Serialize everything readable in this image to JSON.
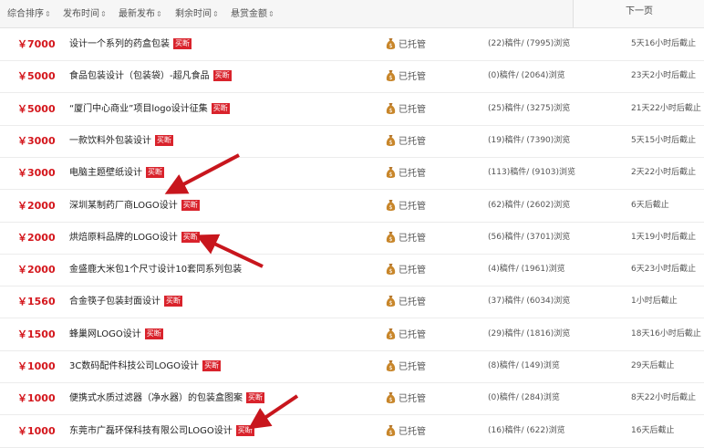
{
  "sort_bar": {
    "items": [
      {
        "label": "综合排序",
        "arrow": "⇕"
      },
      {
        "label": "发布时间",
        "arrow": "⇕"
      },
      {
        "label": "最新发布",
        "arrow": "⇕"
      },
      {
        "label": "剩余时间",
        "arrow": "⇕"
      },
      {
        "label": "悬赏金额",
        "arrow": "⇕"
      }
    ],
    "next_page": "下一页"
  },
  "rows": [
    {
      "price": "￥7000",
      "title": "设计一个系列的药盒包装",
      "tag": "买断",
      "escrow": "已托管",
      "stats": "(22)稿件/ (7995)浏览",
      "deadline": "5天16小时后截止"
    },
    {
      "price": "￥5000",
      "title": "食品包装设计（包装袋）-超凡食品",
      "tag": "买断",
      "escrow": "已托管",
      "stats": "(0)稿件/ (2064)浏览",
      "deadline": "23天2小时后截止"
    },
    {
      "price": "￥5000",
      "title": "“厦门中心商业”项目logo设计征集",
      "tag": "买断",
      "escrow": "已托管",
      "stats": "(25)稿件/ (3275)浏览",
      "deadline": "21天22小时后截止"
    },
    {
      "price": "￥3000",
      "title": "一款饮料外包装设计",
      "tag": "买断",
      "escrow": "已托管",
      "stats": "(19)稿件/ (7390)浏览",
      "deadline": "5天15小时后截止"
    },
    {
      "price": "￥3000",
      "title": "电脑主题壁纸设计",
      "tag": "买断",
      "escrow": "已托管",
      "stats": "(113)稿件/ (9103)浏览",
      "deadline": "2天22小时后截止"
    },
    {
      "price": "￥2000",
      "title": "深圳某制药厂商LOGO设计",
      "tag": "买断",
      "escrow": "已托管",
      "stats": "(62)稿件/ (2602)浏览",
      "deadline": "6天后截止"
    },
    {
      "price": "￥2000",
      "title": "烘焙原料品牌的LOGO设计",
      "tag": "买断",
      "escrow": "已托管",
      "stats": "(56)稿件/ (3701)浏览",
      "deadline": "1天19小时后截止"
    },
    {
      "price": "￥2000",
      "title": "金盛鹿大米包1个尺寸设计10套同系列包装",
      "tag": "",
      "escrow": "已托管",
      "stats": "(4)稿件/ (1961)浏览",
      "deadline": "6天23小时后截止"
    },
    {
      "price": "￥1560",
      "title": "合金筷子包装封面设计",
      "tag": "买断",
      "escrow": "已托管",
      "stats": "(37)稿件/ (6034)浏览",
      "deadline": "1小时后截止"
    },
    {
      "price": "￥1500",
      "title": "蜂巢网LOGO设计",
      "tag": "买断",
      "escrow": "已托管",
      "stats": "(29)稿件/ (1816)浏览",
      "deadline": "18天16小时后截止"
    },
    {
      "price": "￥1000",
      "title": "3C数码配件科技公司LOGO设计",
      "tag": "买断",
      "escrow": "已托管",
      "stats": "(8)稿件/ (149)浏览",
      "deadline": "29天后截止"
    },
    {
      "price": "￥1000",
      "title": "便携式水质过滤器（净水器）的包装盒图案",
      "tag": "买断",
      "escrow": "已托管",
      "stats": "(0)稿件/ (284)浏览",
      "deadline": "8天22小时后截止"
    },
    {
      "price": "￥1000",
      "title": "东莞市广磊环保科技有限公司LOGO设计",
      "tag": "买断",
      "escrow": "已托管",
      "stats": "(16)稿件/ (622)浏览",
      "deadline": "16天后截止"
    }
  ],
  "colors": {
    "accent": "#d4161c",
    "tag_bg": "#d9232c",
    "arrow": "#c8161d",
    "bag": "#c8862a"
  }
}
